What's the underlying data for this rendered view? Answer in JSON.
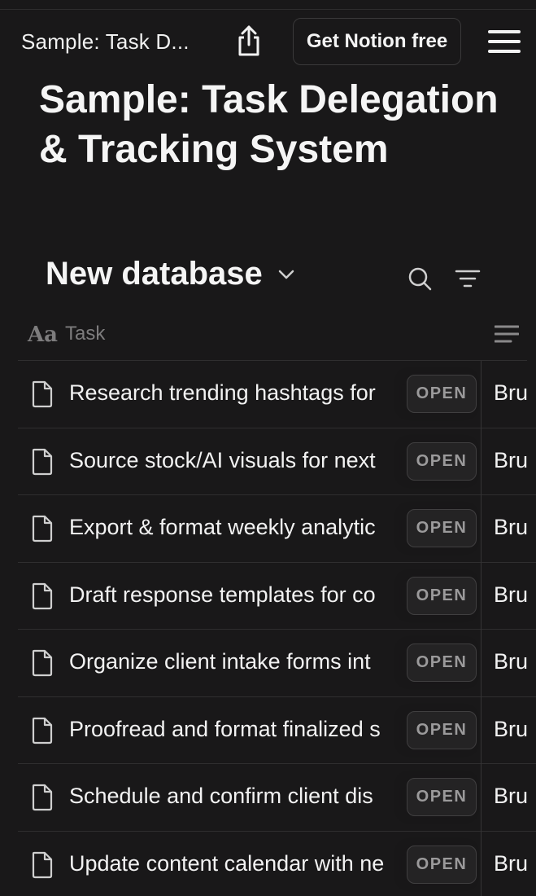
{
  "topbar": {
    "breadcrumb": "Sample: Task D...",
    "share_icon": "share-upload-icon",
    "cta_label": "Get Notion free",
    "menu_icon": "hamburger-menu-icon"
  },
  "page": {
    "title": "Sample: Task Delegation & Tracking System"
  },
  "database": {
    "title": "New database",
    "chevron_icon": "chevron-down-icon",
    "search_icon": "search-icon",
    "filter_icon": "filter-lines-icon"
  },
  "table": {
    "title_column": {
      "type_glyph": "Aa",
      "label": "Task"
    },
    "open_label": "OPEN",
    "rows": [
      {
        "title": "Research trending hashtags for",
        "assignee": "Bru"
      },
      {
        "title": "Source stock/AI visuals for next",
        "assignee": "Bru"
      },
      {
        "title": "Export & format weekly analytic",
        "assignee": "Bru"
      },
      {
        "title": "Draft response templates for co",
        "assignee": "Bru"
      },
      {
        "title": "Organize client intake forms int",
        "assignee": "Bru"
      },
      {
        "title": "Proofread and format finalized s",
        "assignee": "Bru"
      },
      {
        "title": "Schedule and confirm client dis",
        "assignee": "Bru"
      },
      {
        "title": "Update content calendar with ne",
        "assignee": "Bru"
      }
    ]
  },
  "colors": {
    "background": "#191819",
    "text": "#f2f2f2",
    "muted": "#7d7c7d",
    "divider": "#2f2e2f",
    "open_button_bg": "#242324"
  }
}
